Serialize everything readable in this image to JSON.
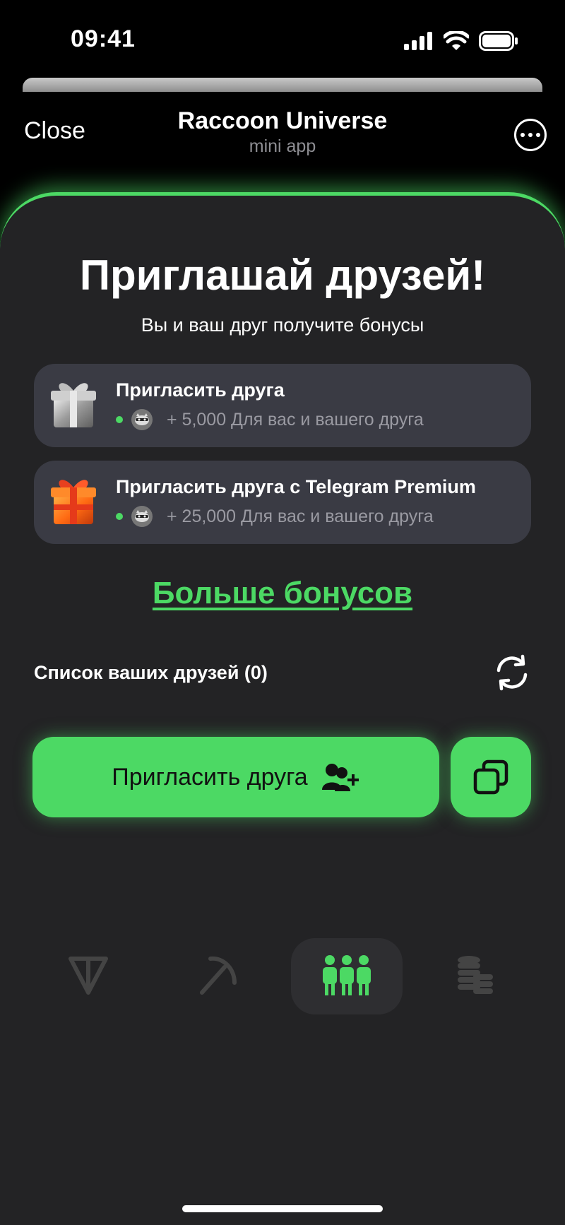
{
  "status_bar": {
    "time": "09:41"
  },
  "header": {
    "close_label": "Close",
    "title": "Raccoon Universe",
    "subtitle": "mini app"
  },
  "main": {
    "heading": "Приглашай друзей!",
    "subheading": "Вы и ваш друг получите бонусы",
    "cards": [
      {
        "title": "Пригласить друга",
        "reward": "+ 5,000 Для вас и вашего друга",
        "icon": "silver-gift-icon"
      },
      {
        "title": "Пригласить друга с Telegram Premium",
        "reward": "+ 25,000 Для вас и вашего друга",
        "icon": "golden-gift-icon"
      }
    ],
    "more_bonuses": "Больше бонусов",
    "friends_list_label": "Список ваших друзей (0)",
    "invite_button_label": "Пригласить друга"
  },
  "nav": {
    "items": [
      {
        "icon": "ton-icon",
        "active": false
      },
      {
        "icon": "pickaxe-icon",
        "active": false
      },
      {
        "icon": "friends-icon",
        "active": true
      },
      {
        "icon": "coins-icon",
        "active": false
      }
    ]
  },
  "colors": {
    "accent": "#4cd964",
    "background": "#232325",
    "card": "#3a3b44"
  }
}
